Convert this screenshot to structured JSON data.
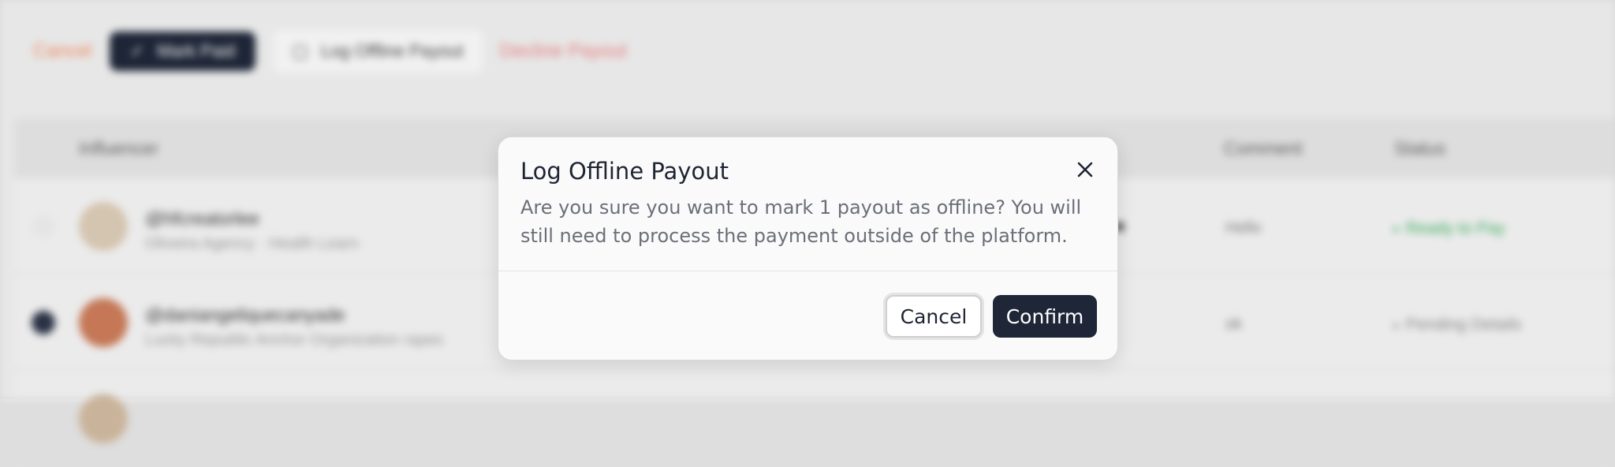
{
  "toolbar": {
    "cancel_label": "Cancel",
    "mark_paid_label": "Mark Paid",
    "log_offline_label": "Log Offline Payout",
    "decline_label": "Decline Payout"
  },
  "table": {
    "headers": {
      "influencer": "Influencer",
      "comment": "Comment",
      "status": "Status"
    },
    "rows": [
      {
        "handle": "@hfcreatorlee",
        "sub": "Oliveira Agency · Health Learn",
        "comment": "Hello",
        "status": "Ready to Pay",
        "status_color": "#3fae61"
      },
      {
        "handle": "@daniangeliquecanyade",
        "sub": "Lucky Republic Anchor Organization rapes",
        "comment": "ok",
        "status": "Pending Details",
        "status_color": "#8a8a8a"
      }
    ]
  },
  "modal": {
    "title": "Log Offline Payout",
    "body": "Are you sure you want to mark 1 payout as offline? You will still need to process the payment outside of the platform.",
    "cancel_label": "Cancel",
    "confirm_label": "Confirm",
    "close_icon": "close-icon"
  },
  "colors": {
    "primary": "#1e2638",
    "warning": "#f08a5d",
    "danger": "#e98080"
  }
}
